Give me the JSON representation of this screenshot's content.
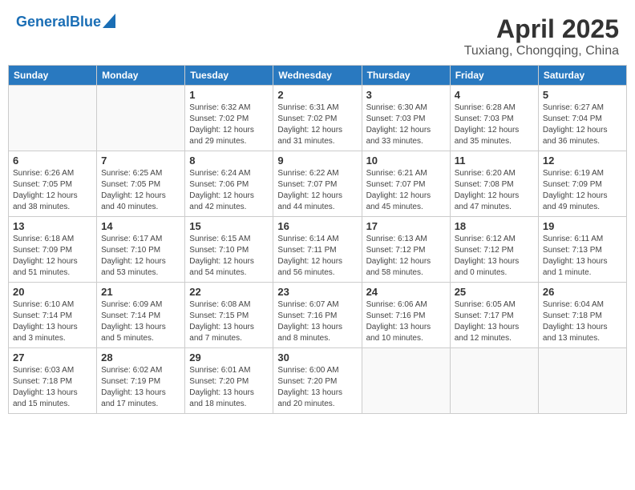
{
  "header": {
    "logo_general": "General",
    "logo_blue": "Blue",
    "month": "April 2025",
    "location": "Tuxiang, Chongqing, China"
  },
  "days_of_week": [
    "Sunday",
    "Monday",
    "Tuesday",
    "Wednesday",
    "Thursday",
    "Friday",
    "Saturday"
  ],
  "weeks": [
    [
      {
        "day": "",
        "info": ""
      },
      {
        "day": "",
        "info": ""
      },
      {
        "day": "1",
        "info": "Sunrise: 6:32 AM\nSunset: 7:02 PM\nDaylight: 12 hours and 29 minutes."
      },
      {
        "day": "2",
        "info": "Sunrise: 6:31 AM\nSunset: 7:02 PM\nDaylight: 12 hours and 31 minutes."
      },
      {
        "day": "3",
        "info": "Sunrise: 6:30 AM\nSunset: 7:03 PM\nDaylight: 12 hours and 33 minutes."
      },
      {
        "day": "4",
        "info": "Sunrise: 6:28 AM\nSunset: 7:03 PM\nDaylight: 12 hours and 35 minutes."
      },
      {
        "day": "5",
        "info": "Sunrise: 6:27 AM\nSunset: 7:04 PM\nDaylight: 12 hours and 36 minutes."
      }
    ],
    [
      {
        "day": "6",
        "info": "Sunrise: 6:26 AM\nSunset: 7:05 PM\nDaylight: 12 hours and 38 minutes."
      },
      {
        "day": "7",
        "info": "Sunrise: 6:25 AM\nSunset: 7:05 PM\nDaylight: 12 hours and 40 minutes."
      },
      {
        "day": "8",
        "info": "Sunrise: 6:24 AM\nSunset: 7:06 PM\nDaylight: 12 hours and 42 minutes."
      },
      {
        "day": "9",
        "info": "Sunrise: 6:22 AM\nSunset: 7:07 PM\nDaylight: 12 hours and 44 minutes."
      },
      {
        "day": "10",
        "info": "Sunrise: 6:21 AM\nSunset: 7:07 PM\nDaylight: 12 hours and 45 minutes."
      },
      {
        "day": "11",
        "info": "Sunrise: 6:20 AM\nSunset: 7:08 PM\nDaylight: 12 hours and 47 minutes."
      },
      {
        "day": "12",
        "info": "Sunrise: 6:19 AM\nSunset: 7:09 PM\nDaylight: 12 hours and 49 minutes."
      }
    ],
    [
      {
        "day": "13",
        "info": "Sunrise: 6:18 AM\nSunset: 7:09 PM\nDaylight: 12 hours and 51 minutes."
      },
      {
        "day": "14",
        "info": "Sunrise: 6:17 AM\nSunset: 7:10 PM\nDaylight: 12 hours and 53 minutes."
      },
      {
        "day": "15",
        "info": "Sunrise: 6:15 AM\nSunset: 7:10 PM\nDaylight: 12 hours and 54 minutes."
      },
      {
        "day": "16",
        "info": "Sunrise: 6:14 AM\nSunset: 7:11 PM\nDaylight: 12 hours and 56 minutes."
      },
      {
        "day": "17",
        "info": "Sunrise: 6:13 AM\nSunset: 7:12 PM\nDaylight: 12 hours and 58 minutes."
      },
      {
        "day": "18",
        "info": "Sunrise: 6:12 AM\nSunset: 7:12 PM\nDaylight: 13 hours and 0 minutes."
      },
      {
        "day": "19",
        "info": "Sunrise: 6:11 AM\nSunset: 7:13 PM\nDaylight: 13 hours and 1 minute."
      }
    ],
    [
      {
        "day": "20",
        "info": "Sunrise: 6:10 AM\nSunset: 7:14 PM\nDaylight: 13 hours and 3 minutes."
      },
      {
        "day": "21",
        "info": "Sunrise: 6:09 AM\nSunset: 7:14 PM\nDaylight: 13 hours and 5 minutes."
      },
      {
        "day": "22",
        "info": "Sunrise: 6:08 AM\nSunset: 7:15 PM\nDaylight: 13 hours and 7 minutes."
      },
      {
        "day": "23",
        "info": "Sunrise: 6:07 AM\nSunset: 7:16 PM\nDaylight: 13 hours and 8 minutes."
      },
      {
        "day": "24",
        "info": "Sunrise: 6:06 AM\nSunset: 7:16 PM\nDaylight: 13 hours and 10 minutes."
      },
      {
        "day": "25",
        "info": "Sunrise: 6:05 AM\nSunset: 7:17 PM\nDaylight: 13 hours and 12 minutes."
      },
      {
        "day": "26",
        "info": "Sunrise: 6:04 AM\nSunset: 7:18 PM\nDaylight: 13 hours and 13 minutes."
      }
    ],
    [
      {
        "day": "27",
        "info": "Sunrise: 6:03 AM\nSunset: 7:18 PM\nDaylight: 13 hours and 15 minutes."
      },
      {
        "day": "28",
        "info": "Sunrise: 6:02 AM\nSunset: 7:19 PM\nDaylight: 13 hours and 17 minutes."
      },
      {
        "day": "29",
        "info": "Sunrise: 6:01 AM\nSunset: 7:20 PM\nDaylight: 13 hours and 18 minutes."
      },
      {
        "day": "30",
        "info": "Sunrise: 6:00 AM\nSunset: 7:20 PM\nDaylight: 13 hours and 20 minutes."
      },
      {
        "day": "",
        "info": ""
      },
      {
        "day": "",
        "info": ""
      },
      {
        "day": "",
        "info": ""
      }
    ]
  ]
}
